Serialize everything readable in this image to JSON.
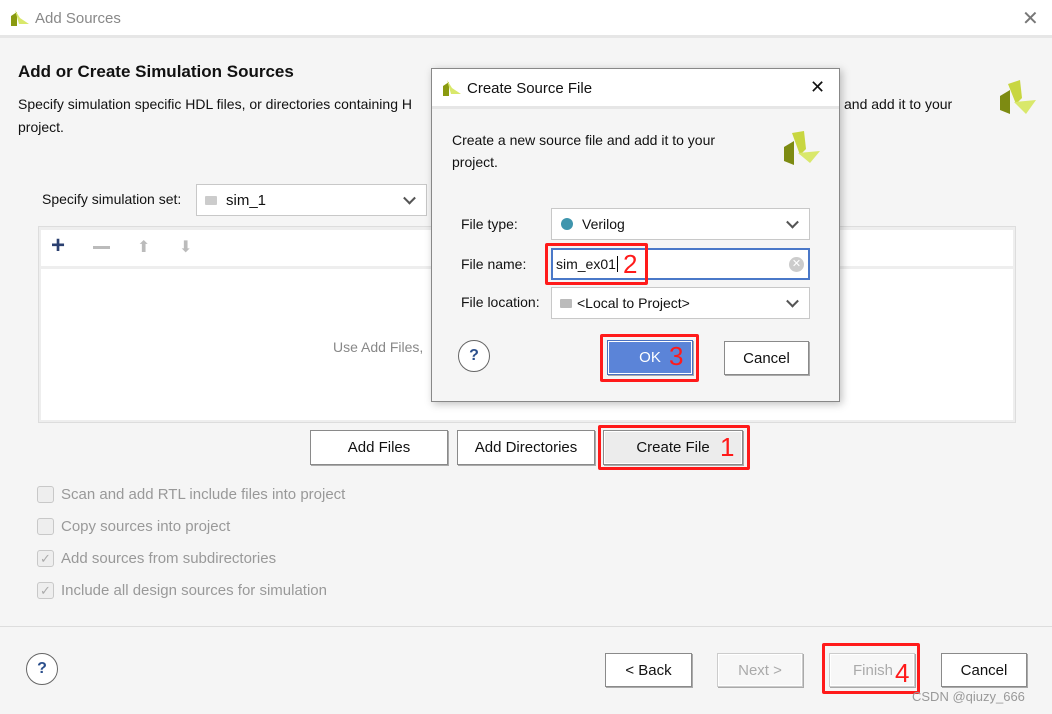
{
  "window": {
    "title": "Add Sources"
  },
  "page": {
    "heading": "Add or Create Simulation Sources",
    "description_line1": "Specify simulation specific HDL files, or directories containing H",
    "description_line1_right": "and add it to your",
    "description_line2": "project."
  },
  "sim_set": {
    "label": "Specify simulation set:",
    "value": "sim_1"
  },
  "list": {
    "empty_text": "Use Add Files,"
  },
  "buttons": {
    "add_files": "Add Files",
    "add_directories": "Add Directories",
    "create_file": "Create File",
    "back": "< Back",
    "next": "Next >",
    "finish": "Finish",
    "cancel": "Cancel",
    "help": "?"
  },
  "options": [
    {
      "label": "Scan and add RTL include files into project",
      "checked": false
    },
    {
      "label": "Copy sources into project",
      "checked": false
    },
    {
      "label": "Add sources from subdirectories",
      "checked": true
    },
    {
      "label": "Include all design sources for simulation",
      "checked": true
    }
  ],
  "dialog": {
    "title": "Create Source File",
    "description": "Create a new source file and add it to your project.",
    "file_type_label": "File type:",
    "file_type_value": "Verilog",
    "file_name_label": "File name:",
    "file_name_value": "sim_ex01",
    "file_location_label": "File location:",
    "file_location_value": "<Local to Project>",
    "ok": "OK",
    "cancel": "Cancel",
    "help": "?"
  },
  "annotations": {
    "step1": "1",
    "step2": "2",
    "step3": "3",
    "step4": "4"
  },
  "watermark": "CSDN @qiuzy_666",
  "colors": {
    "accent_blue": "#5b84d8",
    "annotation_red": "#ff1a1a",
    "verilog_dot": "#3f95ad",
    "logo_dark": "#7d8b12",
    "logo_light": "#d9e86b"
  }
}
